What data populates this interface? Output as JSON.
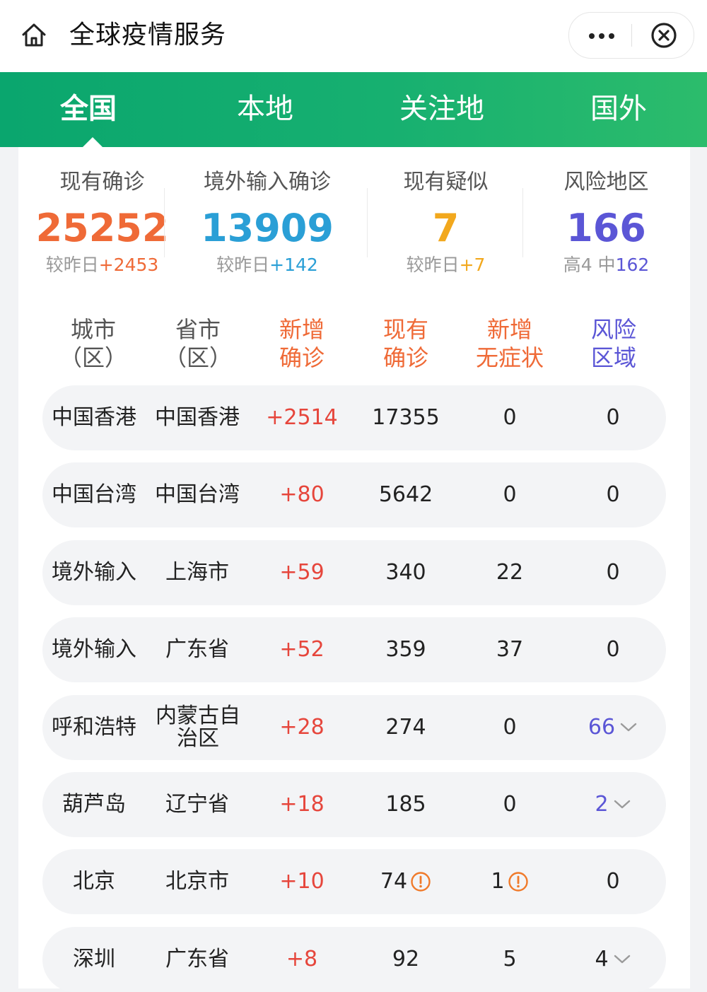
{
  "header": {
    "title": "全球疫情服务",
    "home_icon": "home-icon",
    "more_icon": "more-dots-icon",
    "close_icon": "close-circle-icon"
  },
  "tabs": [
    {
      "label": "全国",
      "active": true
    },
    {
      "label": "本地",
      "active": false
    },
    {
      "label": "关注地",
      "active": false
    },
    {
      "label": "国外",
      "active": false
    }
  ],
  "stats": [
    {
      "label": "现有确诊",
      "value": "25252",
      "sub_prefix": "较昨日",
      "sub_value": "+2453",
      "color": "#ef6a37"
    },
    {
      "label": "境外输入确诊",
      "value": "13909",
      "sub_prefix": "较昨日",
      "sub_value": "+142",
      "color": "#2a9fd6"
    },
    {
      "label": "现有疑似",
      "value": "7",
      "sub_prefix": "较昨日",
      "sub_value": "+7",
      "color": "#f2a81d"
    },
    {
      "label": "风险地区",
      "value": "166",
      "sub_prefix": "高4 中",
      "sub_value": "162",
      "color": "#5b56d6"
    }
  ],
  "columns": [
    {
      "line1": "城市",
      "line2": "（区）",
      "color": "#555555"
    },
    {
      "line1": "省市",
      "line2": "（区）",
      "color": "#555555"
    },
    {
      "line1": "新增",
      "line2": "确诊",
      "color": "#ef6a37"
    },
    {
      "line1": "现有",
      "line2": "确诊",
      "color": "#ef6a37"
    },
    {
      "line1": "新增",
      "line2": "无症状",
      "color": "#ef6a37"
    },
    {
      "line1": "风险",
      "line2": "区域",
      "color": "#5b56d6"
    }
  ],
  "rows": [
    {
      "city": "中国香港",
      "province": "中国香港",
      "new": "+2514",
      "current": "17355",
      "asym": "0",
      "risk": "0"
    },
    {
      "city": "中国台湾",
      "province": "中国台湾",
      "new": "+80",
      "current": "5642",
      "asym": "0",
      "risk": "0"
    },
    {
      "city": "境外输入",
      "province": "上海市",
      "new": "+59",
      "current": "340",
      "asym": "22",
      "risk": "0"
    },
    {
      "city": "境外输入",
      "province": "广东省",
      "new": "+52",
      "current": "359",
      "asym": "37",
      "risk": "0"
    },
    {
      "city": "呼和浩特",
      "province": "内蒙古自治区",
      "new": "+28",
      "current": "274",
      "asym": "0",
      "risk": "66"
    },
    {
      "city": "葫芦岛",
      "province": "辽宁省",
      "new": "+18",
      "current": "185",
      "asym": "0",
      "risk": "2"
    },
    {
      "city": "北京",
      "province": "北京市",
      "new": "+10",
      "current": "74",
      "asym": "1",
      "risk": "0"
    },
    {
      "city": "深圳",
      "province": "广东省",
      "new": "+8",
      "current": "92",
      "asym": "5",
      "risk": "4"
    }
  ],
  "colors": {
    "tab_gradient_start": "#0aa66e",
    "tab_gradient_end": "#2cbc6c",
    "increase_red": "#e6463c",
    "warning_orange": "#f07a2a",
    "risk_purple": "#5b56d6"
  }
}
